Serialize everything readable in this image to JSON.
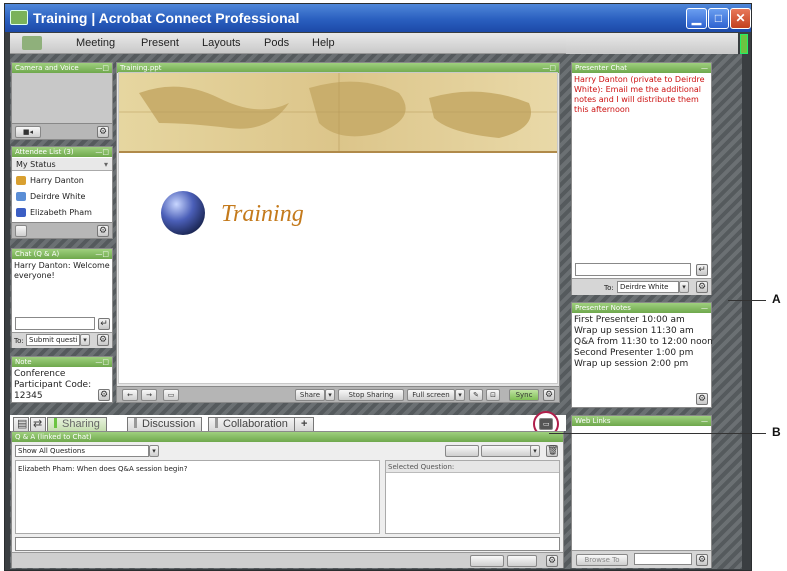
{
  "window": {
    "title": "Training | Acrobat Connect Professional",
    "minimize_icon": "minimize-icon",
    "maximize_icon": "maximize-icon",
    "close_icon": "close-icon"
  },
  "menu": {
    "items": [
      "Meeting",
      "Present",
      "Layouts",
      "Pods",
      "Help"
    ]
  },
  "camera_voice": {
    "title": "Camera and Voice",
    "controls": "—□"
  },
  "attendee_list": {
    "title": "Attendee List (3)",
    "controls": "—□",
    "status_label": "My Status",
    "attendees": [
      "Harry  Danton",
      "Deirdre White",
      "Elizabeth Pham"
    ]
  },
  "chat_qa": {
    "title": "Chat (Q & A)",
    "controls": "—□",
    "message": "Harry  Danton: Welcome everyone!",
    "to_label": "To:",
    "to_value": "Submit questi"
  },
  "note": {
    "title": "Note",
    "controls": "—□",
    "text": "Conference Participant Code: 12345"
  },
  "share": {
    "title": "Training.ppt",
    "controls": "—□",
    "slide_title": "Training",
    "buttons": {
      "share": "Share",
      "stop_sharing": "Stop Sharing",
      "full_screen": "Full screen",
      "sync": "Sync"
    }
  },
  "presenter_chat": {
    "title": "Presenter Chat",
    "controls": "—",
    "message": "Harry  Danton (private to Deirdre White): Email me the additional notes  and I will distribute them this afternoon",
    "to_label": "To:",
    "to_value": "Deirdre White"
  },
  "presenter_notes": {
    "title": "Presenter Notes",
    "controls": "—",
    "lines": [
      "First Presenter 10:00 am",
      "Wrap up session 11:30 am",
      "Q&A from 11:30 to 12:00 noon",
      "Second Presenter 1:00 pm",
      "Wrap up session 2:00 pm"
    ]
  },
  "web_links": {
    "title": "Web Links",
    "controls": "—",
    "browse_label": "Browse To"
  },
  "layout_tabs": {
    "tabs": [
      "Sharing",
      "Discussion",
      "Collaboration"
    ],
    "add_label": "+"
  },
  "qa": {
    "title": "Q & A (linked to Chat)",
    "filter": "Show All Questions",
    "question": "Elizabeth Pham: When does Q&A session begin?",
    "selected_label": "Selected Question:"
  },
  "callouts": {
    "a": "A",
    "b": "B"
  },
  "colors": {
    "pod_header": "#7fb85c",
    "title_bar": "#2a5fbf",
    "private_chat_text": "#cc1111",
    "slide_title": "#c47a1c"
  }
}
